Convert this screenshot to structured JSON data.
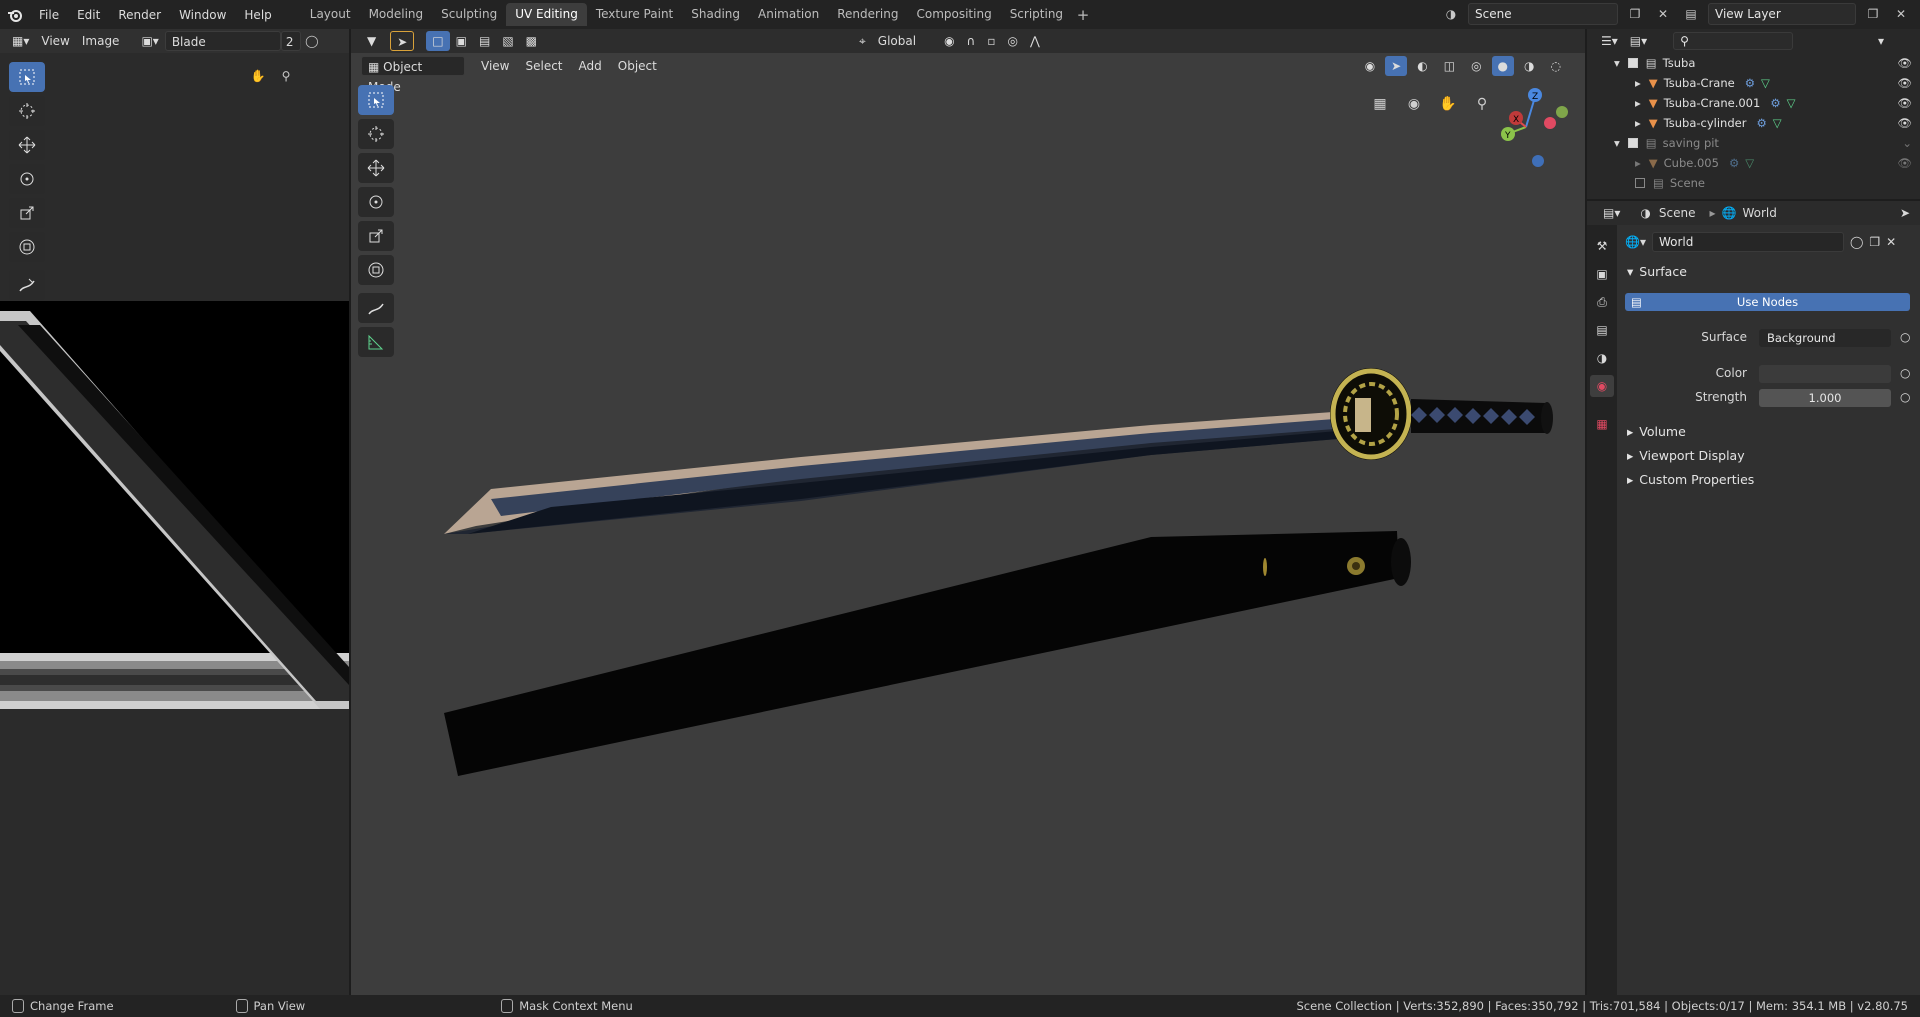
{
  "topbar": {
    "menus": [
      "File",
      "Edit",
      "Render",
      "Window",
      "Help"
    ],
    "workspaces": [
      "Layout",
      "Modeling",
      "Sculpting",
      "UV Editing",
      "Texture Paint",
      "Shading",
      "Animation",
      "Rendering",
      "Compositing",
      "Scripting"
    ],
    "active_workspace": "UV Editing",
    "add_workspace": "+",
    "scene_name": "Scene",
    "view_layer_name": "View Layer"
  },
  "image_editor": {
    "menus": [
      "View",
      "Image"
    ],
    "image_name": "Blade",
    "user_count": "2"
  },
  "viewport": {
    "mode_label": "Object Mode",
    "menus": [
      "View",
      "Select",
      "Add",
      "Object"
    ],
    "orientation": "Global",
    "axis_labels": {
      "x": "X",
      "y": "Y",
      "z": "Z"
    }
  },
  "outliner": {
    "rows": [
      {
        "label": "Tsuba",
        "kind": "collection",
        "dim": false
      },
      {
        "label": "Tsuba-Crane",
        "kind": "object",
        "dim": false
      },
      {
        "label": "Tsuba-Crane.001",
        "kind": "object",
        "dim": false
      },
      {
        "label": "Tsuba-cylinder",
        "kind": "object",
        "dim": false
      },
      {
        "label": "saving pit",
        "kind": "collection",
        "dim": true
      },
      {
        "label": "Cube.005",
        "kind": "object",
        "dim": true
      },
      {
        "label": "Scene",
        "kind": "collection",
        "dim": true
      }
    ]
  },
  "properties": {
    "breadcrumb_scene": "Scene",
    "breadcrumb_world": "World",
    "world_name": "World",
    "panels": {
      "surface": "Surface",
      "use_nodes": "Use Nodes",
      "surface_label": "Surface",
      "surface_value": "Background",
      "color_label": "Color",
      "strength_label": "Strength",
      "strength_value": "1.000",
      "volume": "Volume",
      "viewport_display": "Viewport Display",
      "custom_properties": "Custom Properties"
    }
  },
  "statusbar": {
    "left_action": "Change Frame",
    "middle_action": "Pan View",
    "right_action": "Mask Context Menu",
    "stats": "Scene Collection | Verts:352,890 | Faces:350,792 | Tris:701,584 | Objects:0/17 | Mem: 354.1 MB | v2.80.75"
  },
  "colors": {
    "accent": "#4772b3",
    "orange_object": "#e8914a",
    "green_mesh": "#5fd38d"
  }
}
